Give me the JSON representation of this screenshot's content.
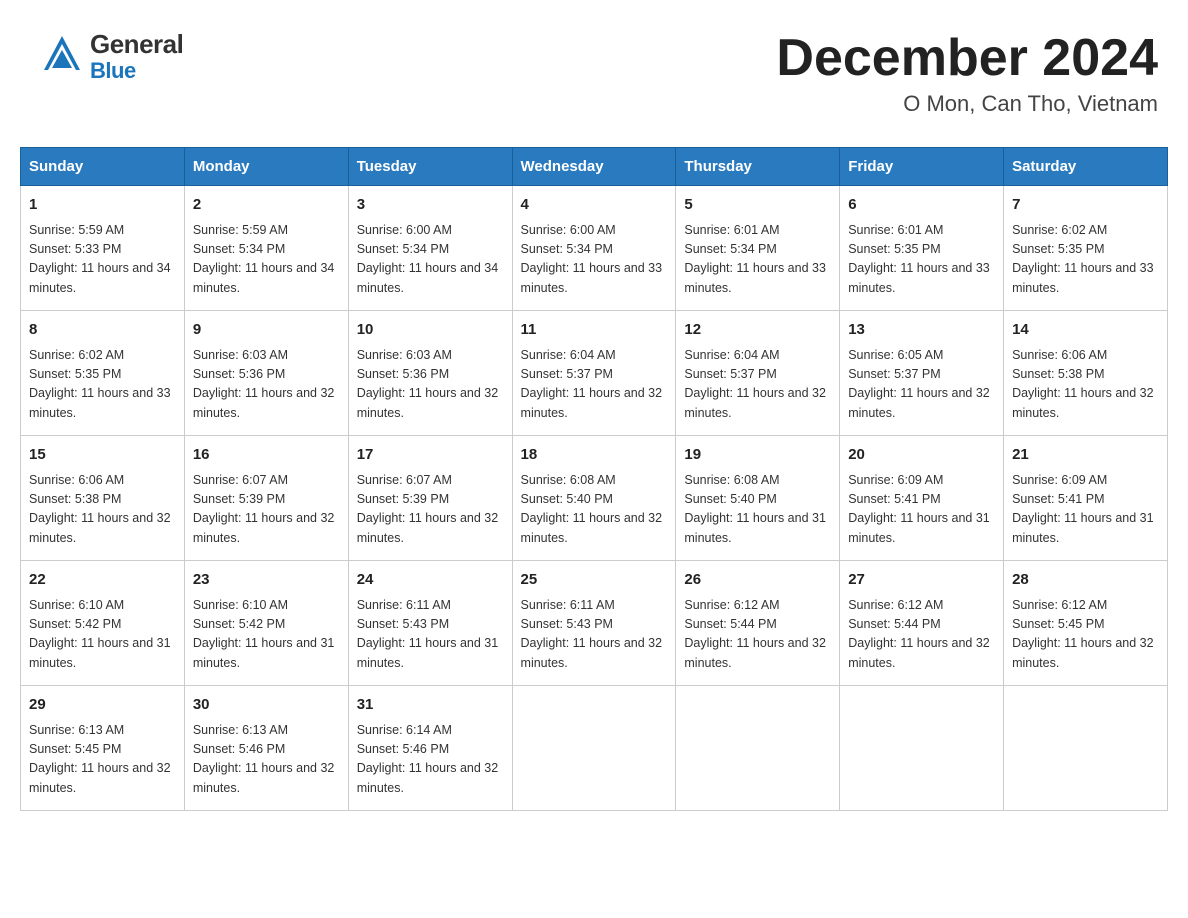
{
  "header": {
    "logo_general": "General",
    "logo_blue": "Blue",
    "month_year": "December 2024",
    "location": "O Mon, Can Tho, Vietnam"
  },
  "calendar": {
    "days_of_week": [
      "Sunday",
      "Monday",
      "Tuesday",
      "Wednesday",
      "Thursday",
      "Friday",
      "Saturday"
    ],
    "weeks": [
      [
        {
          "day": "1",
          "sunrise": "Sunrise: 5:59 AM",
          "sunset": "Sunset: 5:33 PM",
          "daylight": "Daylight: 11 hours and 34 minutes."
        },
        {
          "day": "2",
          "sunrise": "Sunrise: 5:59 AM",
          "sunset": "Sunset: 5:34 PM",
          "daylight": "Daylight: 11 hours and 34 minutes."
        },
        {
          "day": "3",
          "sunrise": "Sunrise: 6:00 AM",
          "sunset": "Sunset: 5:34 PM",
          "daylight": "Daylight: 11 hours and 34 minutes."
        },
        {
          "day": "4",
          "sunrise": "Sunrise: 6:00 AM",
          "sunset": "Sunset: 5:34 PM",
          "daylight": "Daylight: 11 hours and 33 minutes."
        },
        {
          "day": "5",
          "sunrise": "Sunrise: 6:01 AM",
          "sunset": "Sunset: 5:34 PM",
          "daylight": "Daylight: 11 hours and 33 minutes."
        },
        {
          "day": "6",
          "sunrise": "Sunrise: 6:01 AM",
          "sunset": "Sunset: 5:35 PM",
          "daylight": "Daylight: 11 hours and 33 minutes."
        },
        {
          "day": "7",
          "sunrise": "Sunrise: 6:02 AM",
          "sunset": "Sunset: 5:35 PM",
          "daylight": "Daylight: 11 hours and 33 minutes."
        }
      ],
      [
        {
          "day": "8",
          "sunrise": "Sunrise: 6:02 AM",
          "sunset": "Sunset: 5:35 PM",
          "daylight": "Daylight: 11 hours and 33 minutes."
        },
        {
          "day": "9",
          "sunrise": "Sunrise: 6:03 AM",
          "sunset": "Sunset: 5:36 PM",
          "daylight": "Daylight: 11 hours and 32 minutes."
        },
        {
          "day": "10",
          "sunrise": "Sunrise: 6:03 AM",
          "sunset": "Sunset: 5:36 PM",
          "daylight": "Daylight: 11 hours and 32 minutes."
        },
        {
          "day": "11",
          "sunrise": "Sunrise: 6:04 AM",
          "sunset": "Sunset: 5:37 PM",
          "daylight": "Daylight: 11 hours and 32 minutes."
        },
        {
          "day": "12",
          "sunrise": "Sunrise: 6:04 AM",
          "sunset": "Sunset: 5:37 PM",
          "daylight": "Daylight: 11 hours and 32 minutes."
        },
        {
          "day": "13",
          "sunrise": "Sunrise: 6:05 AM",
          "sunset": "Sunset: 5:37 PM",
          "daylight": "Daylight: 11 hours and 32 minutes."
        },
        {
          "day": "14",
          "sunrise": "Sunrise: 6:06 AM",
          "sunset": "Sunset: 5:38 PM",
          "daylight": "Daylight: 11 hours and 32 minutes."
        }
      ],
      [
        {
          "day": "15",
          "sunrise": "Sunrise: 6:06 AM",
          "sunset": "Sunset: 5:38 PM",
          "daylight": "Daylight: 11 hours and 32 minutes."
        },
        {
          "day": "16",
          "sunrise": "Sunrise: 6:07 AM",
          "sunset": "Sunset: 5:39 PM",
          "daylight": "Daylight: 11 hours and 32 minutes."
        },
        {
          "day": "17",
          "sunrise": "Sunrise: 6:07 AM",
          "sunset": "Sunset: 5:39 PM",
          "daylight": "Daylight: 11 hours and 32 minutes."
        },
        {
          "day": "18",
          "sunrise": "Sunrise: 6:08 AM",
          "sunset": "Sunset: 5:40 PM",
          "daylight": "Daylight: 11 hours and 32 minutes."
        },
        {
          "day": "19",
          "sunrise": "Sunrise: 6:08 AM",
          "sunset": "Sunset: 5:40 PM",
          "daylight": "Daylight: 11 hours and 31 minutes."
        },
        {
          "day": "20",
          "sunrise": "Sunrise: 6:09 AM",
          "sunset": "Sunset: 5:41 PM",
          "daylight": "Daylight: 11 hours and 31 minutes."
        },
        {
          "day": "21",
          "sunrise": "Sunrise: 6:09 AM",
          "sunset": "Sunset: 5:41 PM",
          "daylight": "Daylight: 11 hours and 31 minutes."
        }
      ],
      [
        {
          "day": "22",
          "sunrise": "Sunrise: 6:10 AM",
          "sunset": "Sunset: 5:42 PM",
          "daylight": "Daylight: 11 hours and 31 minutes."
        },
        {
          "day": "23",
          "sunrise": "Sunrise: 6:10 AM",
          "sunset": "Sunset: 5:42 PM",
          "daylight": "Daylight: 11 hours and 31 minutes."
        },
        {
          "day": "24",
          "sunrise": "Sunrise: 6:11 AM",
          "sunset": "Sunset: 5:43 PM",
          "daylight": "Daylight: 11 hours and 31 minutes."
        },
        {
          "day": "25",
          "sunrise": "Sunrise: 6:11 AM",
          "sunset": "Sunset: 5:43 PM",
          "daylight": "Daylight: 11 hours and 32 minutes."
        },
        {
          "day": "26",
          "sunrise": "Sunrise: 6:12 AM",
          "sunset": "Sunset: 5:44 PM",
          "daylight": "Daylight: 11 hours and 32 minutes."
        },
        {
          "day": "27",
          "sunrise": "Sunrise: 6:12 AM",
          "sunset": "Sunset: 5:44 PM",
          "daylight": "Daylight: 11 hours and 32 minutes."
        },
        {
          "day": "28",
          "sunrise": "Sunrise: 6:12 AM",
          "sunset": "Sunset: 5:45 PM",
          "daylight": "Daylight: 11 hours and 32 minutes."
        }
      ],
      [
        {
          "day": "29",
          "sunrise": "Sunrise: 6:13 AM",
          "sunset": "Sunset: 5:45 PM",
          "daylight": "Daylight: 11 hours and 32 minutes."
        },
        {
          "day": "30",
          "sunrise": "Sunrise: 6:13 AM",
          "sunset": "Sunset: 5:46 PM",
          "daylight": "Daylight: 11 hours and 32 minutes."
        },
        {
          "day": "31",
          "sunrise": "Sunrise: 6:14 AM",
          "sunset": "Sunset: 5:46 PM",
          "daylight": "Daylight: 11 hours and 32 minutes."
        },
        {
          "day": "",
          "sunrise": "",
          "sunset": "",
          "daylight": ""
        },
        {
          "day": "",
          "sunrise": "",
          "sunset": "",
          "daylight": ""
        },
        {
          "day": "",
          "sunrise": "",
          "sunset": "",
          "daylight": ""
        },
        {
          "day": "",
          "sunrise": "",
          "sunset": "",
          "daylight": ""
        }
      ]
    ]
  }
}
